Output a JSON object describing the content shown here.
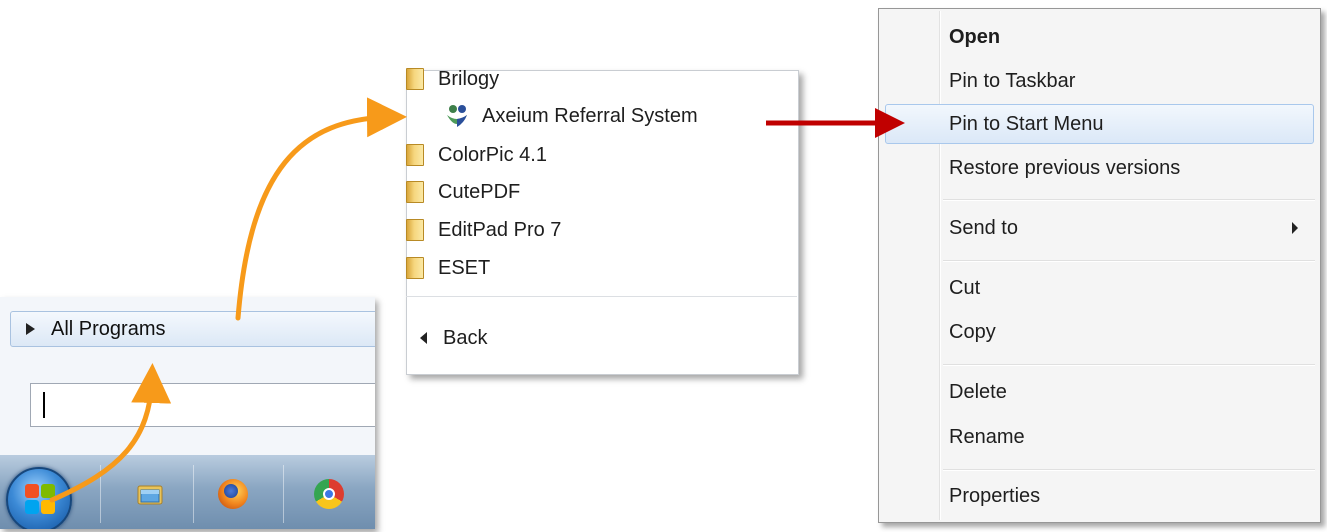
{
  "start_menu": {
    "all_programs_label": "All Programs",
    "search_value": ""
  },
  "programs_menu": {
    "items": [
      {
        "label": "Brilogy",
        "icon": "folder-icon"
      },
      {
        "label": "Axeium Referral System",
        "icon": "axeium-app-icon"
      },
      {
        "label": "ColorPic 4.1",
        "icon": "folder-icon"
      },
      {
        "label": "CutePDF",
        "icon": "folder-icon"
      },
      {
        "label": "EditPad Pro 7",
        "icon": "folder-icon"
      },
      {
        "label": "ESET",
        "icon": "folder-icon"
      }
    ],
    "back_label": "Back"
  },
  "context_menu": {
    "items": [
      {
        "label": "Open"
      },
      {
        "label": "Pin to Taskbar"
      },
      {
        "label": "Pin to Start Menu"
      },
      {
        "label": "Restore previous versions"
      },
      {
        "label": "Send to"
      },
      {
        "label": "Cut"
      },
      {
        "label": "Copy"
      },
      {
        "label": "Delete"
      },
      {
        "label": "Rename"
      },
      {
        "label": "Properties"
      }
    ]
  },
  "taskbar": {
    "icons": [
      "start-orb-icon",
      "windows-explorer-icon",
      "firefox-icon",
      "chrome-icon"
    ]
  },
  "colors": {
    "orange_arrow": "#f79a1a",
    "red_arrow": "#c00000",
    "hover_bg": "#dbe8f7"
  }
}
